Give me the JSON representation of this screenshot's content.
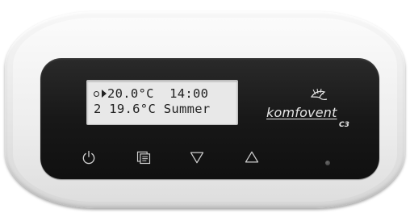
{
  "display": {
    "line1": {
      "mode_icon": "clock-icon",
      "indicator_icon": "play-arrow-icon",
      "setpoint_temp": "20.0°C",
      "time": "14:00"
    },
    "line2": {
      "speed_level": "2",
      "current_temp": "19.6°C",
      "season": "Summer"
    }
  },
  "brand": {
    "name": "komfovent",
    "model": "C3",
    "logo_icon": "bird-logo-icon"
  },
  "buttons": [
    {
      "icon": "power-icon"
    },
    {
      "icon": "menu-icon"
    },
    {
      "icon": "down-triangle-icon"
    },
    {
      "icon": "up-triangle-icon"
    }
  ],
  "indicator": {
    "icon": "status-led"
  },
  "colors": {
    "body": "#e9e9e9",
    "panel": "#181818",
    "lcd_background": "#e8e8e8",
    "lcd_text": "#222222",
    "button_icon": "#cfcfcf",
    "brand_text": "#e6e6e6"
  }
}
